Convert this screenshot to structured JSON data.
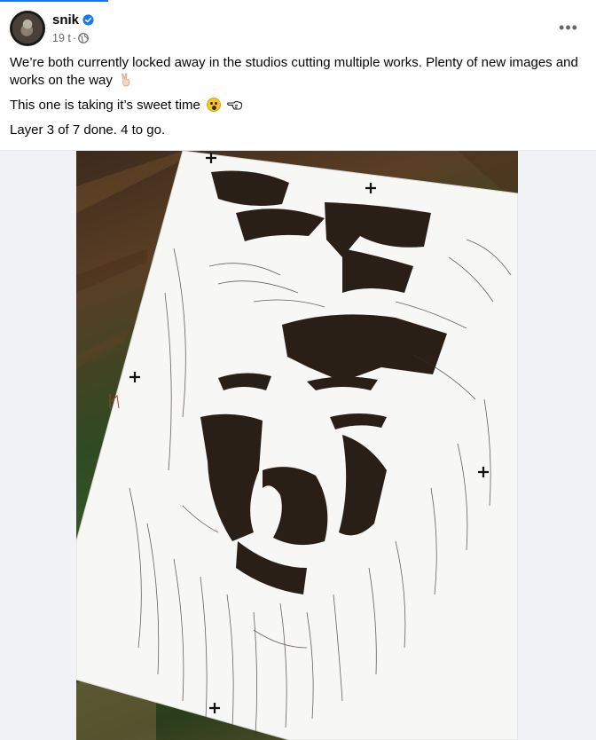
{
  "post": {
    "author": "snik",
    "verified": true,
    "time": "19 t",
    "separator": "·",
    "more_label": "•••",
    "paragraphs": [
      "We’re both currently locked away in the studios cutting multiple works. Plenty of new images and works on the way",
      "This one is taking it’s sweet time",
      "Layer 3 of 7 done. 4 to go."
    ],
    "icons": {
      "verified": "verified-badge-icon",
      "audience": "globe-icon",
      "emoji1": "victory-hand-emoji",
      "emoji2": "astonished-face-emoji",
      "emoji3": "pointing-left-hand-emoji"
    },
    "photo_alt": "Paper cut stencil of a face on white paper lying on a wooden surface"
  },
  "colors": {
    "accent": "#1877f2",
    "text": "#050505",
    "meta": "#65676b"
  }
}
